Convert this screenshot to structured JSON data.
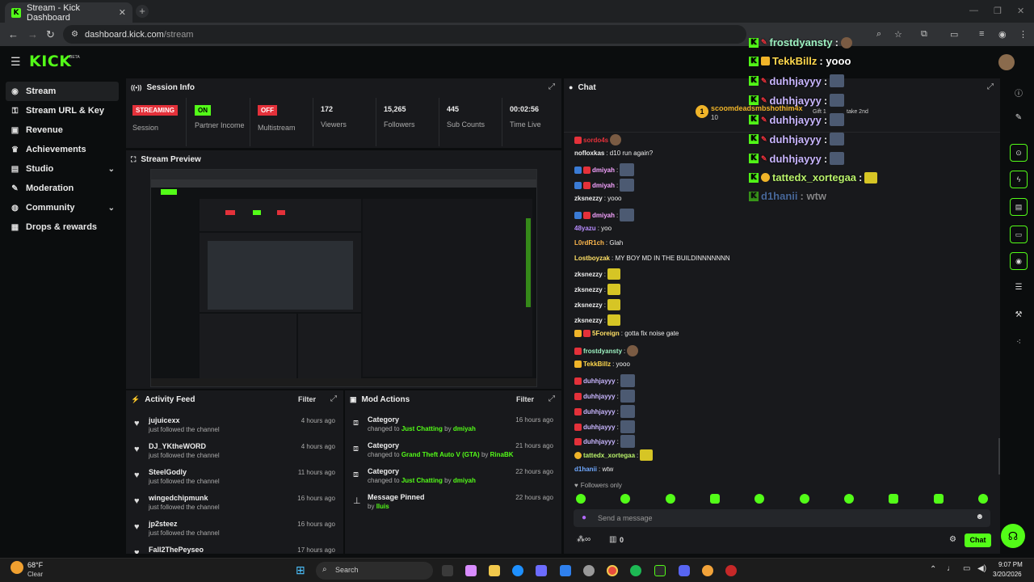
{
  "browser": {
    "tab_title": "Stream - Kick Dashboard",
    "tab_close": "✕",
    "new_tab": "+",
    "url_host": "dashboard.kick.com",
    "url_path": "/stream"
  },
  "kick": {
    "logo": "KICK",
    "beta": "BETA"
  },
  "sidebar": {
    "items": [
      {
        "label": "Stream",
        "icon": "stream-icon"
      },
      {
        "label": "Stream URL & Key",
        "icon": "key-icon"
      },
      {
        "label": "Revenue",
        "icon": "wallet-icon"
      },
      {
        "label": "Achievements",
        "icon": "trophy-icon"
      },
      {
        "label": "Studio",
        "icon": "studio-icon"
      },
      {
        "label": "Moderation",
        "icon": "wrench-icon"
      },
      {
        "label": "Community",
        "icon": "globe-icon"
      },
      {
        "label": "Drops & rewards",
        "icon": "gift-icon"
      }
    ]
  },
  "session": {
    "title": "Session Info",
    "stats": [
      {
        "badge": "STREAMING",
        "label": "Session"
      },
      {
        "badge": "ON",
        "label": "Partner Income"
      },
      {
        "badge": "OFF",
        "label": "Multistream"
      },
      {
        "value": "172",
        "label": "Viewers"
      },
      {
        "value": "15,265",
        "label": "Followers"
      },
      {
        "value": "445",
        "label": "Sub Counts"
      },
      {
        "value": "00:02:56",
        "label": "Time Live"
      }
    ]
  },
  "preview": {
    "title": "Stream Preview"
  },
  "activity": {
    "title": "Activity Feed",
    "filter": "Filter",
    "rows": [
      {
        "name": "jujuicexx",
        "sub": "just followed the channel",
        "time": "4 hours ago"
      },
      {
        "name": "DJ_YKtheWORD",
        "sub": "just followed the channel",
        "time": "4 hours ago"
      },
      {
        "name": "SteelGodly",
        "sub": "just followed the channel",
        "time": "11 hours ago"
      },
      {
        "name": "wingedchipmunk",
        "sub": "just followed the channel",
        "time": "16 hours ago"
      },
      {
        "name": "jp2steez",
        "sub": "just followed the channel",
        "time": "16 hours ago"
      },
      {
        "name": "Fall2ThePeyseo",
        "sub": "",
        "time": "17 hours ago"
      }
    ]
  },
  "mod": {
    "title": "Mod Actions",
    "filter": "Filter",
    "rows": [
      {
        "name": "Category",
        "pre": "changed to",
        "target": "Just Chatting",
        "by": "by",
        "user": "dmiyah",
        "time": "16 hours ago"
      },
      {
        "name": "Category",
        "pre": "changed to",
        "target": "Grand Theft Auto V (GTA)",
        "by": "by",
        "user": "RinaBK",
        "time": "21 hours ago"
      },
      {
        "name": "Category",
        "pre": "changed to",
        "target": "Just Chatting",
        "by": "by",
        "user": "dmiyah",
        "time": "22 hours ago"
      },
      {
        "name": "Message Pinned",
        "pre": "by",
        "target": "lluis",
        "by": "",
        "user": "",
        "time": "22 hours ago"
      }
    ]
  },
  "chat": {
    "title": "Chat",
    "gifter": "scoomdeadsmbshothim4x",
    "gift_count": "10",
    "gift_text": "Gift 1",
    "take_2nd": "take 2nd",
    "lines": [
      {
        "user": "sordo4s",
        "text": "",
        "color": "#e4313a",
        "emote": "b"
      },
      {
        "user": "nofloxkas",
        "text": ": d10 run again?",
        "color": "#eeeeee"
      },
      {
        "user": "dmiyah",
        "text": ":",
        "color": "#f5a3ff",
        "emote": "g"
      },
      {
        "user": "dmiyah",
        "text": ":",
        "color": "#f5a3ff",
        "emote": "g"
      },
      {
        "user": "zksnezzy",
        "text": ": yooo",
        "color": "#eeeeee"
      },
      {
        "user": "dmiyah",
        "text": ":",
        "color": "#f5a3ff",
        "emote": "g"
      },
      {
        "user": "48yazu",
        "text": ": yoo",
        "color": "#b88cff"
      },
      {
        "user": "L0rdR1ch",
        "text": ": Glah",
        "color": "#ffb84d"
      },
      {
        "user": "Lostboyzak",
        "text": ": MY BOY MD IN THE BUILDINNNNNNN",
        "color": "#ffe066"
      },
      {
        "user": "zksnezzy",
        "text": ":",
        "color": "#eeeeee",
        "emote": "y"
      },
      {
        "user": "zksnezzy",
        "text": ":",
        "color": "#eeeeee",
        "emote": "y"
      },
      {
        "user": "zksnezzy",
        "text": ":",
        "color": "#eeeeee",
        "emote": "y"
      },
      {
        "user": "zksnezzy",
        "text": ":",
        "color": "#eeeeee",
        "emote": "y"
      },
      {
        "user": "5Foreign",
        "text": ": gotta fix noise gate",
        "color": "#ffe066"
      },
      {
        "user": "frostdyansty",
        "text": ":",
        "color": "#9cf0c0",
        "emote": "b"
      },
      {
        "user": "TekkBillz",
        "text": ": yooo",
        "color": "#ffd84d"
      },
      {
        "user": "duhhjayyy",
        "text": ":",
        "color": "#c9b6ff",
        "emote": "g"
      },
      {
        "user": "duhhjayyy",
        "text": ":",
        "color": "#c9b6ff",
        "emote": "g"
      },
      {
        "user": "duhhjayyy",
        "text": ":",
        "color": "#c9b6ff",
        "emote": "g"
      },
      {
        "user": "duhhjayyy",
        "text": ":",
        "color": "#c9b6ff",
        "emote": "g"
      },
      {
        "user": "duhhjayyy",
        "text": ":",
        "color": "#c9b6ff",
        "emote": "g"
      },
      {
        "user": "tattedx_xortegaa",
        "text": ":",
        "color": "#b8f06a",
        "emote": "y"
      },
      {
        "user": "d1hanii",
        "text": ": wtw",
        "color": "#6fa8ff"
      }
    ],
    "followers_only": "Followers only",
    "placeholder": "Send a message",
    "count": "0",
    "send": "Chat"
  },
  "overlay": {
    "lines": [
      {
        "user": "frostdyansty",
        "text": ":",
        "color": "#9cf0c0"
      },
      {
        "user": "TekkBillz",
        "text": ": yooo",
        "color": "#ffd84d"
      },
      {
        "user": "duhhjayyy",
        "text": ":",
        "color": "#c9b6ff"
      },
      {
        "user": "duhhjayyy",
        "text": ":",
        "color": "#c9b6ff"
      },
      {
        "user": "duhhjayyy",
        "text": ":",
        "color": "#c9b6ff"
      },
      {
        "user": "duhhjayyy",
        "text": ":",
        "color": "#c9b6ff"
      },
      {
        "user": "duhhjayyy",
        "text": ":",
        "color": "#c9b6ff"
      },
      {
        "user": "tattedx_xortegaa",
        "text": ":",
        "color": "#b8f06a"
      },
      {
        "user": "d1hanii",
        "text": ": wtw",
        "color": "#6fa8ff"
      }
    ]
  },
  "taskbar": {
    "weather_temp": "68°F",
    "weather_desc": "Clear",
    "search": "Search",
    "time": "9:07 PM",
    "date": "3/20/2026"
  },
  "colors": {
    "accent": "#53fc18",
    "live_red": "#e4313a"
  }
}
